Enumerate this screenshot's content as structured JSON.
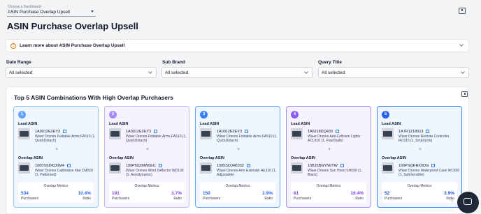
{
  "dashboard": {
    "label": "Choose a Dashboard",
    "selected": "ASIN Purchase Overlap Upsell"
  },
  "title": "ASIN Purchase Overlap Upsell",
  "info": {
    "text": "Learn more about ASIN Purchase Overlap Upsell",
    "icon": "info-icon"
  },
  "filters": [
    {
      "label": "Date Range",
      "value": "All selected"
    },
    {
      "label": "Sub Brand",
      "value": "All selected"
    },
    {
      "label": "Query Title",
      "value": "All selected"
    }
  ],
  "panel": {
    "title": "Top 5 ASIN Combinations With High Overlap Purchasers"
  },
  "labels": {
    "lead": "Lead ASIN",
    "overlap": "Overlap ASIN",
    "metrics": "Overlap Metrics",
    "purchasers": "Purchasers",
    "ratio": "Ratio",
    "plus": "+"
  },
  "colors": {
    "card1": {
      "bg": "#eff6ff",
      "border": "#93c5fd",
      "badge": "#60a5fa",
      "metric": "#2563eb"
    },
    "card2": {
      "bg": "#f5f3ff",
      "border": "#c4b5fd",
      "badge": "#a78bfa",
      "metric": "#7c3aed"
    },
    "card3": {
      "bg": "#eff6ff",
      "border": "#60a5fa",
      "badge": "#3b82f6",
      "metric": "#2563eb"
    },
    "card4": {
      "bg": "#f5f3ff",
      "border": "#a78bfa",
      "badge": "#8b5cf6",
      "metric": "#7c3aed"
    },
    "card5": {
      "bg": "#eff6ff",
      "border": "#3b82f6",
      "badge": "#2563eb",
      "metric": "#1d4ed8"
    }
  },
  "cards": [
    {
      "rank": "1",
      "lead_asin": "1A0012E2EY3",
      "lead_name": "Wiser Drones Foldable Arms FA510 (1, QuickDetach)",
      "overlap_asin": "1000SSDKD0M4",
      "overlap_name": "Wiser Drones Calibration Mat CM020 (1, Patterned)",
      "purchasers": "534",
      "ratio": "10.4%"
    },
    {
      "rank": "2",
      "lead_asin": "1A0012E2EY3",
      "lead_name": "Wiser Drones Foldable Arms FA510 (1, QuickDetach)",
      "overlap_asin": "100P50ZMW0EC",
      "overlap_name": "Wiser Drones Wind Deflector WD130 (1, Aerodynamic)",
      "purchasers": "191",
      "ratio": "3.7%"
    },
    {
      "rank": "3",
      "lead_asin": "1A0012E2EY3",
      "lead_name": "Wiser Drones Foldable Arms FA510 (1, QuickDetach)",
      "overlap_asin": "1005SOJ4K032",
      "overlap_name": "Wiser Drones Arm Extender AE110 (1, Adjustable)",
      "purchasers": "150",
      "ratio": "2.9%"
    },
    {
      "rank": "4",
      "lead_asin": "1A8J18DQ433",
      "lead_name": "Wiser Drones Anti-Collision Lights ACL810 (1, FlashSafe)",
      "overlap_asin": "10BJ5BGYN0TW",
      "overlap_name": "Wiser Drones Sun Hood SH030 (1, Black)",
      "purchasers": "61",
      "ratio": "16.4%"
    },
    {
      "rank": "5",
      "lead_asin": "1A7R1Z18513",
      "lead_name": "Wiser Drones Remote Controller RC910 (1, SmartLink)",
      "overlap_asin": "100PSQKRX0DG",
      "overlap_name": "Wiser Drones Waterproof Case WC820 (1, Submersible)",
      "purchasers": "52",
      "ratio": "3.9%"
    }
  ]
}
